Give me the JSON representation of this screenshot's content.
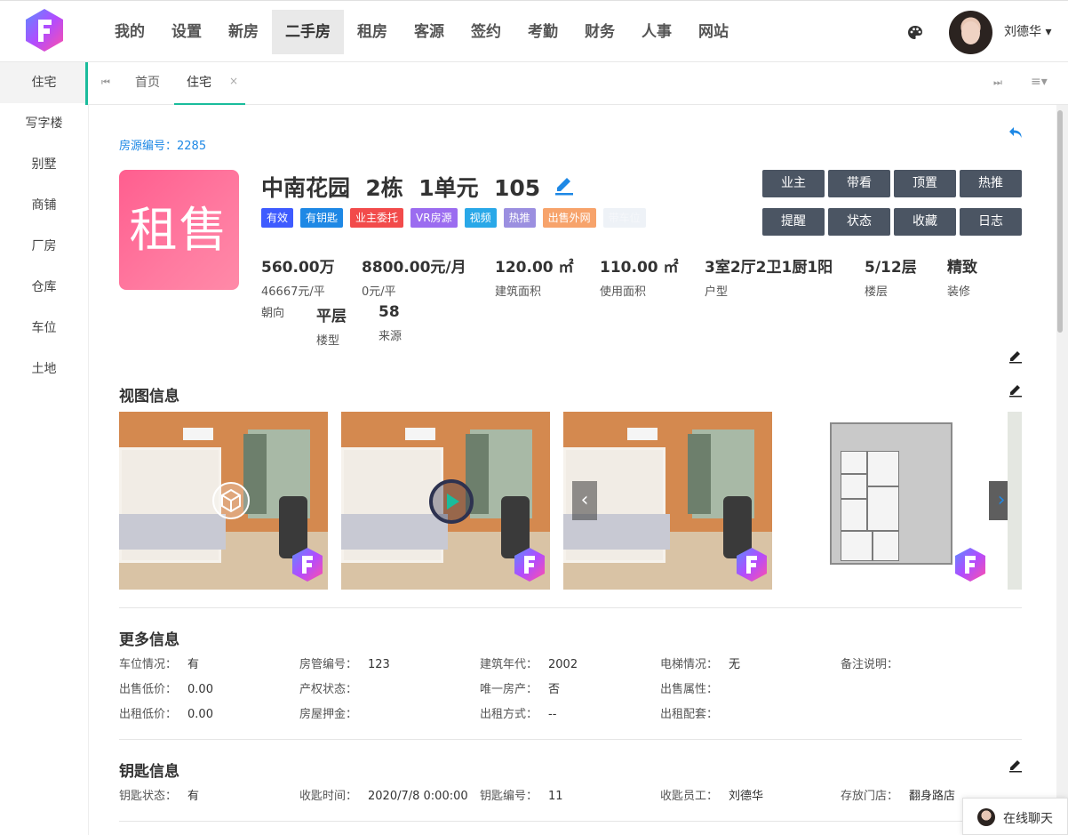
{
  "nav": {
    "items": [
      "我的",
      "设置",
      "新房",
      "二手房",
      "租房",
      "客源",
      "签约",
      "考勤",
      "财务",
      "人事",
      "网站"
    ],
    "active": "二手房",
    "user_name": "刘德华 ▾"
  },
  "sidebar": {
    "items": [
      "住宅",
      "写字楼",
      "别墅",
      "商铺",
      "厂房",
      "仓库",
      "车位",
      "土地"
    ]
  },
  "tabs": {
    "home": "首页",
    "current": "住宅",
    "close": "×",
    "first": "⏮",
    "last": "⏭",
    "menu": "≡▾"
  },
  "house": {
    "id_text": "房源编号：2285",
    "badge": "租售",
    "title": "中南花园  2栋  1单元  105",
    "tags": [
      {
        "label": "有效",
        "color": "#3e5bff"
      },
      {
        "label": "有钥匙",
        "color": "#1e88e5"
      },
      {
        "label": "业主委托",
        "color": "#f24b4b"
      },
      {
        "label": "VR房源",
        "color": "#9b6cf0"
      },
      {
        "label": "视频",
        "color": "#29a8e8"
      },
      {
        "label": "热推",
        "color": "#9b8fe0"
      },
      {
        "label": "出售外网",
        "color": "#f7a36b"
      },
      {
        "label": "带车位",
        "color": "#eef2f7"
      }
    ],
    "actions": [
      "业主",
      "带看",
      "顶置",
      "热推",
      "提醒",
      "状态",
      "收藏",
      "日志"
    ],
    "stats": [
      {
        "value": "560.00万",
        "key": "46667元/平"
      },
      {
        "value": "8800.00元/月",
        "key": "0元/平"
      },
      {
        "value": "120.00 ㎡",
        "key": "建筑面积"
      },
      {
        "value": "110.00 ㎡",
        "key": "使用面积"
      },
      {
        "value": "3室2厅2卫1厨1阳",
        "key": "户型"
      },
      {
        "value": "5/12层",
        "key": "楼层"
      },
      {
        "value": "精致",
        "key": "装修"
      }
    ],
    "stats2": [
      {
        "value": "",
        "key": "朝向"
      },
      {
        "value": "平层",
        "key": "楼型"
      },
      {
        "value": "58",
        "key": "来源"
      }
    ]
  },
  "sections": {
    "gallery_title": "视图信息",
    "more_title": "更多信息",
    "key_title": "钥匙信息"
  },
  "more_info": [
    {
      "label": "车位情况：",
      "value": "有"
    },
    {
      "label": "房管编号：",
      "value": "123"
    },
    {
      "label": "建筑年代：",
      "value": "2002"
    },
    {
      "label": "电梯情况：",
      "value": "无"
    },
    {
      "label": "备注说明：",
      "value": ""
    },
    {
      "label": "出售低价：",
      "value": "0.00"
    },
    {
      "label": "产权状态：",
      "value": ""
    },
    {
      "label": "唯一房产：",
      "value": "否"
    },
    {
      "label": "出售属性：",
      "value": ""
    },
    {
      "label": "出租低价：",
      "value": "0.00"
    },
    {
      "label": "房屋押金：",
      "value": ""
    },
    {
      "label": "出租方式：",
      "value": "--"
    },
    {
      "label": "出租配套：",
      "value": ""
    }
  ],
  "key_info": [
    {
      "label": "钥匙状态：",
      "value": "有"
    },
    {
      "label": "收匙时间：",
      "value": "2020/7/8 0:00:00"
    },
    {
      "label": "钥匙编号：",
      "value": "11"
    },
    {
      "label": "收匙员工：",
      "value": "刘德华"
    },
    {
      "label": "存放门店：",
      "value": "翻身路店"
    }
  ],
  "chat": {
    "label": "在线聊天"
  },
  "colors": {
    "accent": "#1abc9c",
    "link": "#1e88e5",
    "button": "#4b5563"
  },
  "icons": [
    "logo-icon",
    "palette-icon",
    "undo-icon",
    "edit-icon",
    "vr-icon",
    "play-icon",
    "chevron-left-icon",
    "chevron-right-icon"
  ]
}
